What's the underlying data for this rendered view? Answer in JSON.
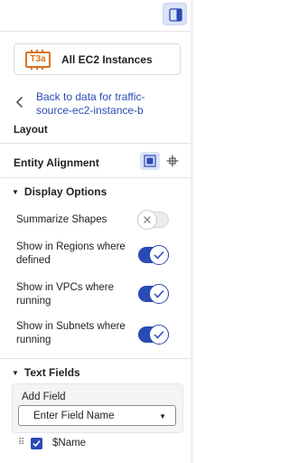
{
  "toolbar": {
    "toggle_icon": "panel-right-icon"
  },
  "entity": {
    "badge_text": "T3a",
    "title": "All EC2 Instances",
    "badge_color": "#d8731e"
  },
  "back_link": {
    "text": "Back to data for traffic-source-ec2-instance-b"
  },
  "layout": {
    "label": "Layout"
  },
  "entity_alignment": {
    "label": "Entity Alignment",
    "active_option": "grid"
  },
  "display_options": {
    "header": "Display Options",
    "items": [
      {
        "label": "Summarize Shapes",
        "enabled": false
      },
      {
        "label": "Show in Regions where defined",
        "enabled": true
      },
      {
        "label": "Show in VPCs where running",
        "enabled": true
      },
      {
        "label": "Show in Subnets where running",
        "enabled": true
      }
    ]
  },
  "text_fields": {
    "header": "Text Fields",
    "add_field_label": "Add Field",
    "select_placeholder": "Enter Field Name",
    "fields": [
      {
        "name": "$Name",
        "checked": true
      }
    ]
  },
  "colors": {
    "accent": "#2a4bb5",
    "active_bg": "#dbe3f7"
  }
}
